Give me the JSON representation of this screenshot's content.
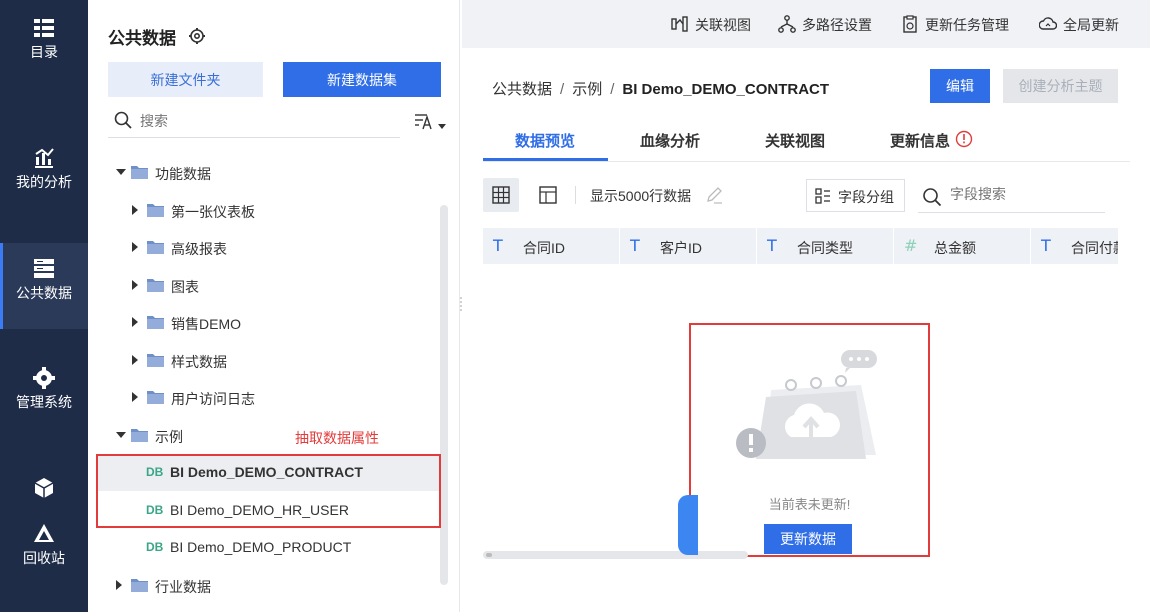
{
  "nav": {
    "items": [
      {
        "label": "目录",
        "icon": "catalog-icon"
      },
      {
        "label": "我的分析",
        "icon": "analysis-icon"
      },
      {
        "label": "公共数据",
        "icon": "public-data-icon",
        "active": true
      },
      {
        "label": "管理系统",
        "icon": "gear-icon"
      },
      {
        "label": "回收站",
        "icon": "recycle-icon"
      }
    ]
  },
  "tree_panel": {
    "title": "公共数据",
    "new_folder_label": "新建文件夹",
    "new_dataset_label": "新建数据集",
    "search_placeholder": "搜索",
    "rows": [
      {
        "label": "功能数据",
        "type": "folder",
        "expanded": true
      },
      {
        "label": "第一张仪表板",
        "type": "folder"
      },
      {
        "label": "高级报表",
        "type": "folder"
      },
      {
        "label": "图表",
        "type": "folder"
      },
      {
        "label": "销售DEMO",
        "type": "folder"
      },
      {
        "label": "样式数据",
        "type": "folder"
      },
      {
        "label": "用户访问日志",
        "type": "folder"
      },
      {
        "label": "示例",
        "type": "folder",
        "expanded": true
      },
      {
        "label": "BI Demo_DEMO_CONTRACT",
        "type": "table",
        "badge": "DB",
        "selected": true
      },
      {
        "label": "BI Demo_DEMO_HR_USER",
        "type": "table",
        "badge": "DB"
      },
      {
        "label": "BI Demo_DEMO_PRODUCT",
        "type": "table",
        "badge": "DB"
      },
      {
        "label": "行业数据",
        "type": "folder"
      }
    ],
    "annotation": "抽取数据属性"
  },
  "topbar": {
    "related_view": "关联视图",
    "multipath": "多路径设置",
    "update_task": "更新任务管理",
    "global_update": "全局更新"
  },
  "breadcrumb": {
    "root": "公共数据",
    "separator": "/",
    "folder": "示例",
    "current": "BI Demo_DEMO_CONTRACT"
  },
  "actions": {
    "edit": "编辑",
    "create_subject": "创建分析主题"
  },
  "tabs": [
    {
      "label": "数据预览",
      "active": true
    },
    {
      "label": "血缘分析"
    },
    {
      "label": "关联视图"
    },
    {
      "label": "更新信息"
    }
  ],
  "toolbar": {
    "show_rows": "显示5000行数据",
    "field_group": "字段分组",
    "field_search_placeholder": "字段搜索"
  },
  "table": {
    "columns": [
      {
        "label": "合同ID",
        "type_icon": "T"
      },
      {
        "label": "客户ID",
        "type_icon": "T"
      },
      {
        "label": "合同类型",
        "type_icon": "T"
      },
      {
        "label": "总金额",
        "type_icon": "#"
      },
      {
        "label": "合同付款类型",
        "type_icon": "T"
      }
    ]
  },
  "empty_state": {
    "message": "当前表未更新!",
    "button": "更新数据"
  },
  "colors": {
    "nav_bg": "#1f2c48",
    "primary": "#2f6ee6",
    "annotation_red": "#e23b3b",
    "db_badge": "#3aa587"
  }
}
